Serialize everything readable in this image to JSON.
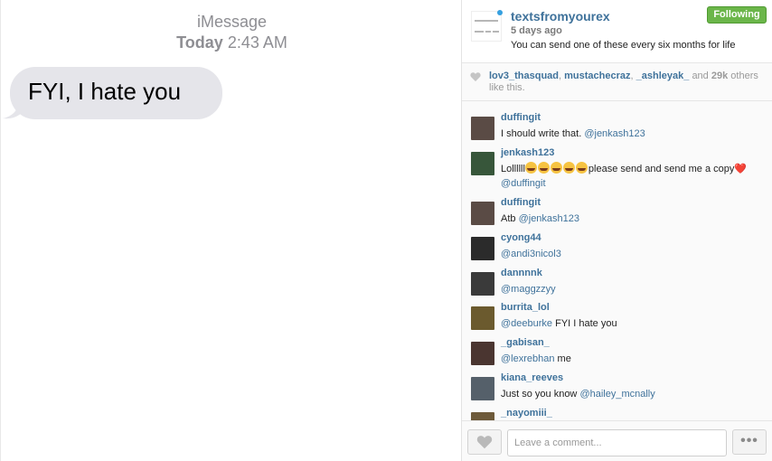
{
  "photo": {
    "app_name": "iMessage",
    "timestamp_day": "Today",
    "timestamp_time": "2:43 AM",
    "message": "FYI, I hate you"
  },
  "post": {
    "username": "textsfromyourex",
    "age": "5 days ago",
    "caption": "You can send one of these every six months for life",
    "follow_label": "Following",
    "accent_color": "#6bb64a"
  },
  "likes": {
    "users": [
      "lov3_thasquad",
      "mustachecraz",
      "_ashleyak_"
    ],
    "and_word": "and",
    "count": "29k",
    "suffix": "others like this."
  },
  "comments": [
    {
      "user": "duffingit",
      "avatar_color": "#5a4b45",
      "parts": [
        {
          "t": "I should write that. "
        },
        {
          "m": "@jenkash123"
        }
      ]
    },
    {
      "user": "jenkash123",
      "avatar_color": "#37563a",
      "parts": [
        {
          "t": "Lollllll"
        },
        {
          "e": 5
        },
        {
          "t": "please send and send me a copy"
        },
        {
          "h": "❤️"
        },
        {
          "t": " "
        },
        {
          "m": "@duffingit"
        }
      ]
    },
    {
      "user": "duffingit",
      "avatar_color": "#5a4b45",
      "parts": [
        {
          "t": "Atb "
        },
        {
          "m": "@jenkash123"
        }
      ]
    },
    {
      "user": "cyong44",
      "avatar_color": "#2b2b2b",
      "parts": [
        {
          "m": "@andi3nicol3"
        }
      ]
    },
    {
      "user": "dannnnk",
      "avatar_color": "#3a3a3a",
      "parts": [
        {
          "m": "@maggzzyy"
        }
      ]
    },
    {
      "user": "burrita_lol",
      "avatar_color": "#6b5a2e",
      "parts": [
        {
          "m": "@deeburke"
        },
        {
          "t": " FYI I hate you"
        }
      ]
    },
    {
      "user": "_gabisan_",
      "avatar_color": "#4a3530",
      "parts": [
        {
          "m": "@lexrebhan"
        },
        {
          "t": " me"
        }
      ]
    },
    {
      "user": "kiana_reeves",
      "avatar_color": "#55606a",
      "parts": [
        {
          "t": "Just so you know "
        },
        {
          "m": "@hailey_mcnally"
        }
      ]
    },
    {
      "user": "_nayomiii_",
      "avatar_color": "#6e5a3a",
      "parts": []
    }
  ],
  "footer": {
    "comment_placeholder": "Leave a comment...",
    "more_label": "•••"
  }
}
